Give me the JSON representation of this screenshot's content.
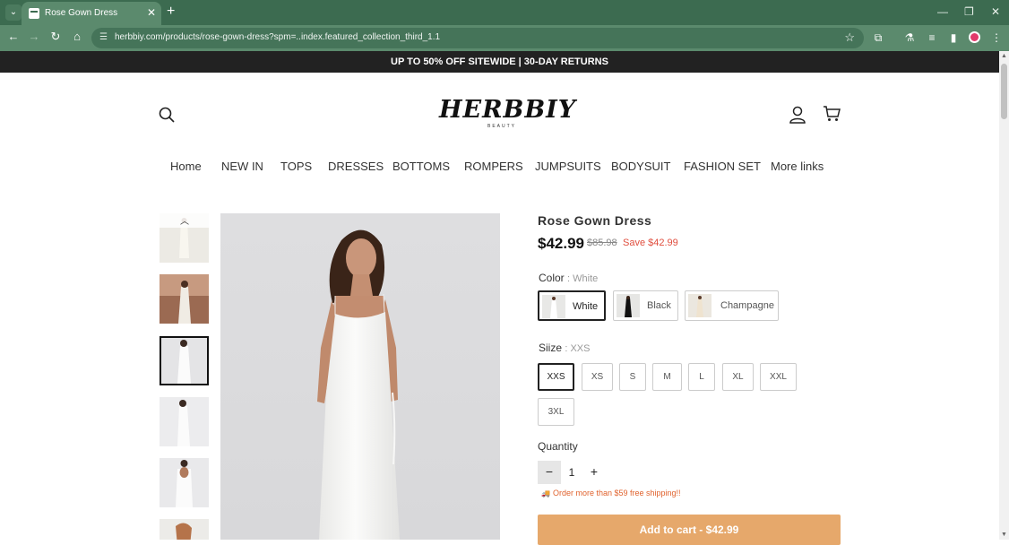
{
  "browser": {
    "tab_title": "Rose Gown Dress",
    "url": "herbbiy.com/products/rose-gown-dress?spm=..index.featured_collection_third_1.1",
    "icons": [
      "back-icon",
      "forward-icon",
      "reload-icon",
      "home-icon",
      "site-info-icon",
      "star-icon",
      "extensions-icon",
      "labs-icon",
      "reading-list-icon",
      "side-panel-icon",
      "profile-icon",
      "kebab-menu-icon"
    ]
  },
  "promo": {
    "text": "UP TO 50% OFF SITEWIDE | 30-DAY RETURNS"
  },
  "header": {
    "logo_main": "HERBBIY",
    "logo_sub": "BEAUTY"
  },
  "nav": {
    "links": [
      "Home",
      "NEW IN",
      "TOPS",
      "DRESSES",
      "BOTTOMS",
      "ROMPERS",
      "JUMPSUITS",
      "BODYSUIT",
      "FASHION SET",
      "More links"
    ]
  },
  "product": {
    "title": "Rose Gown Dress",
    "price": "$42.99",
    "compare_price": "$85.98",
    "save": "Save $42.99",
    "color_label": "Color",
    "color_selected": ": White",
    "colors": [
      "White",
      "Black",
      "Champagne"
    ],
    "size_label": "Siize",
    "size_selected": ": XXS",
    "sizes": [
      "XXS",
      "XS",
      "S",
      "M",
      "L",
      "XL",
      "XXL",
      "3XL"
    ],
    "quantity_label": "Quantity",
    "quantity": "1",
    "qty_minus": "−",
    "qty_plus": "+",
    "shipping_note": "Order more than $59 free shipping!!",
    "add_to_cart": "Add to cart  -  $42.99"
  },
  "colors": {
    "promo_bg": "#222222",
    "add_to_cart": "#e6a86b",
    "sale": "#e04e3e",
    "shipping": "#e0622d"
  }
}
